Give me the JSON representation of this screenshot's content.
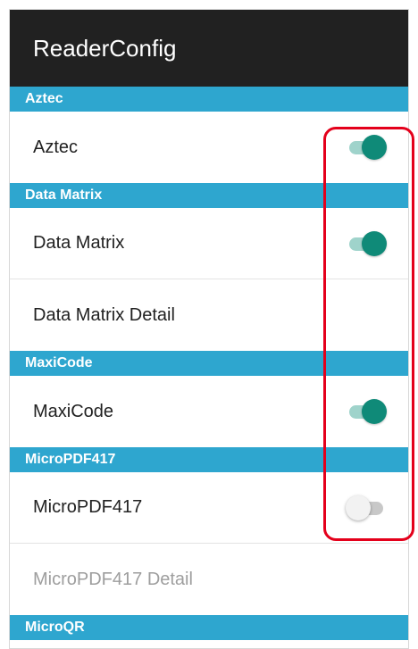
{
  "appbar": {
    "title": "ReaderConfig"
  },
  "sections": {
    "aztec": {
      "header": "Aztec",
      "toggle": {
        "label": "Aztec",
        "checked": true
      }
    },
    "datamatrix": {
      "header": "Data Matrix",
      "toggle": {
        "label": "Data Matrix",
        "checked": true
      },
      "detail": {
        "label": "Data Matrix Detail"
      }
    },
    "maxicode": {
      "header": "MaxiCode",
      "toggle": {
        "label": "MaxiCode",
        "checked": true
      }
    },
    "micropdf": {
      "header": "MicroPDF417",
      "toggle": {
        "label": "MicroPDF417",
        "checked": false
      },
      "detail": {
        "label": "MicroPDF417 Detail",
        "enabled": false
      }
    },
    "microqr": {
      "header": "MicroQR"
    }
  },
  "colors": {
    "appbar": "#212121",
    "section_header": "#2ea6cf",
    "switch_on": "#0f8a78",
    "highlight": "#e4001b"
  }
}
